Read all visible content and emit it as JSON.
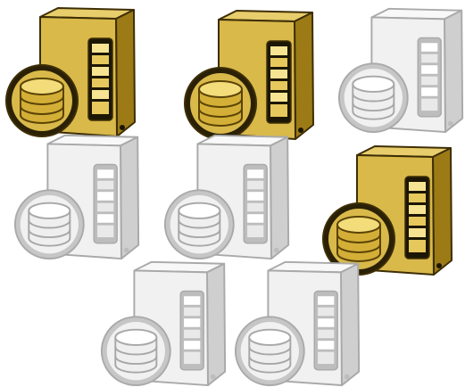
{
  "palette": {
    "gold": {
      "front": "#d9b94a",
      "side": "#9c7b16",
      "top": "#e8cd6c",
      "edge": "#3d2e05",
      "bay": "#1c1604",
      "slat": "#e6c85c",
      "slat_hi": "#f6e493",
      "db": "#d4af37",
      "db_hi": "#f3dc7a",
      "db_edge": "#5a4306",
      "ring": "#2a2006"
    },
    "silver": {
      "front": "#f1f1f1",
      "side": "#cfcfcf",
      "top": "#f8f8f8",
      "edge": "#a9a9a9",
      "bay": "#bdbdbd",
      "slat": "#e9e9e9",
      "slat_hi": "#ffffff",
      "db": "#efefef",
      "db_hi": "#ffffff",
      "db_edge": "#a7a7a7",
      "ring": "#c6c6c6"
    }
  },
  "servers": [
    {
      "name": "database-server-icon",
      "variant": "gold",
      "state": "active"
    },
    {
      "name": "database-server-icon",
      "variant": "gold",
      "state": "active"
    },
    {
      "name": "database-server-icon",
      "variant": "silver",
      "state": "inactive"
    },
    {
      "name": "database-server-icon",
      "variant": "silver",
      "state": "inactive"
    },
    {
      "name": "database-server-icon",
      "variant": "silver",
      "state": "inactive"
    },
    {
      "name": "database-server-icon",
      "variant": "gold",
      "state": "active"
    },
    {
      "name": "database-server-icon",
      "variant": "silver",
      "state": "inactive"
    },
    {
      "name": "database-server-icon",
      "variant": "silver",
      "state": "inactive"
    }
  ]
}
